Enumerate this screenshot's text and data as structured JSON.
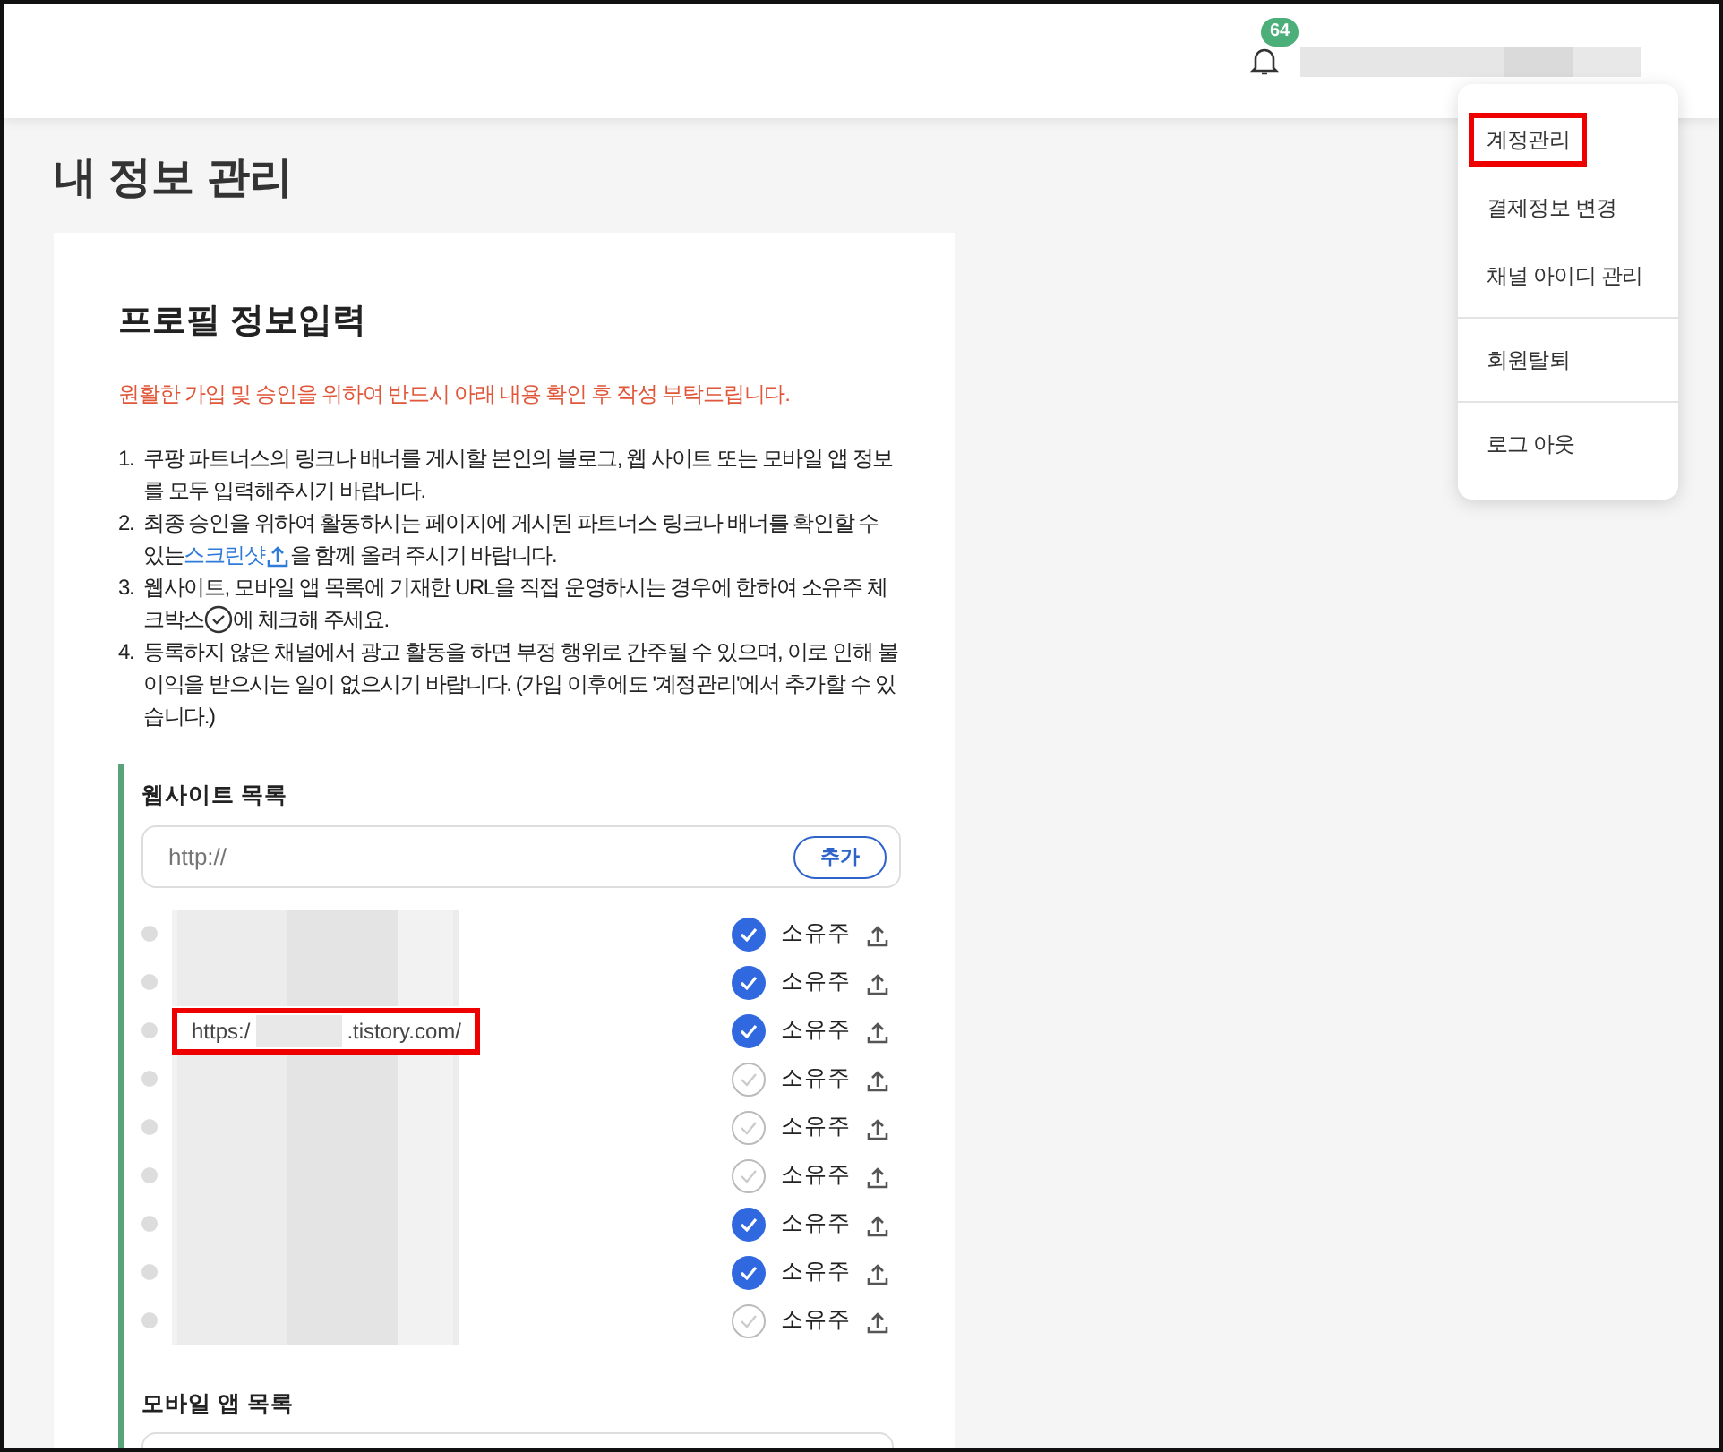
{
  "header": {
    "notification_count": "64"
  },
  "account_menu": {
    "groups": [
      {
        "items": [
          {
            "label": "계정관리",
            "highlighted": true
          },
          {
            "label": "결제정보 변경",
            "highlighted": false
          },
          {
            "label": "채널 아이디 관리",
            "highlighted": false
          }
        ]
      },
      {
        "items": [
          {
            "label": "회원탈퇴",
            "highlighted": false
          }
        ]
      },
      {
        "items": [
          {
            "label": "로그 아웃",
            "highlighted": false
          }
        ]
      }
    ]
  },
  "page_title": "내 정보 관리",
  "card": {
    "title": "프로필 정보입력",
    "notice": "원활한 가입 및 승인을 위하여 반드시 아래 내용 확인 후 작성 부탁드립니다.",
    "instructions": [
      {
        "number": "1.",
        "parts": [
          {
            "kind": "text",
            "text": "쿠팡 파트너스의 링크나 배너를 게시할 본인의 블로그, 웹 사이트 또는 모바일 앱 정보를 모두 입력해주시기 바랍니다."
          }
        ]
      },
      {
        "number": "2.",
        "parts": [
          {
            "kind": "text",
            "text": "최종 승인을 위하여 활동하시는 페이지에 게시된 파트너스 링크나 배너를 확인할 수 있는"
          },
          {
            "kind": "link",
            "text": "스크린샷"
          },
          {
            "kind": "upload_icon"
          },
          {
            "kind": "text",
            "text": "을 함께 올려 주시기 바랍니다."
          }
        ]
      },
      {
        "number": "3.",
        "parts": [
          {
            "kind": "text",
            "text": "웹사이트, 모바일 앱 목록에 기재한 URL을 직접 운영하시는 경우에 한하여 소유주 체크박스"
          },
          {
            "kind": "check_icon"
          },
          {
            "kind": "text",
            "text": "에 체크해 주세요."
          }
        ]
      },
      {
        "number": "4.",
        "parts": [
          {
            "kind": "text",
            "text": "등록하지 않은 채널에서 광고 활동을 하면 부정 행위로 간주될 수 있으며, 이로 인해 불이익을 받으시는 일이 없으시기 바랍니다. (가입 이후에도 '계정관리'에서 추가할 수 있습니다.)"
          }
        ]
      }
    ],
    "website_section": {
      "title": "웹사이트 목록",
      "placeholder": "http://",
      "add_button": "추가",
      "rows": [
        {
          "kind": "redacted",
          "owner": true,
          "owner_label": "소유주",
          "highlighted": false
        },
        {
          "kind": "redacted",
          "owner": true,
          "owner_label": "소유주",
          "highlighted": false
        },
        {
          "kind": "url",
          "url_start": "https:/",
          "url_end": ".tistory.com/",
          "owner": true,
          "owner_label": "소유주",
          "highlighted": true
        },
        {
          "kind": "redacted",
          "owner": false,
          "owner_label": "소유주",
          "highlighted": false
        },
        {
          "kind": "redacted",
          "owner": false,
          "owner_label": "소유주",
          "highlighted": false
        },
        {
          "kind": "redacted",
          "owner": false,
          "owner_label": "소유주",
          "highlighted": false
        },
        {
          "kind": "redacted",
          "owner": true,
          "owner_label": "소유주",
          "highlighted": false
        },
        {
          "kind": "redacted",
          "owner": true,
          "owner_label": "소유주",
          "highlighted": false
        },
        {
          "kind": "redacted",
          "owner": false,
          "owner_label": "소유주",
          "highlighted": false
        }
      ]
    },
    "mobile_section": {
      "title": "모바일 앱 목록"
    }
  }
}
